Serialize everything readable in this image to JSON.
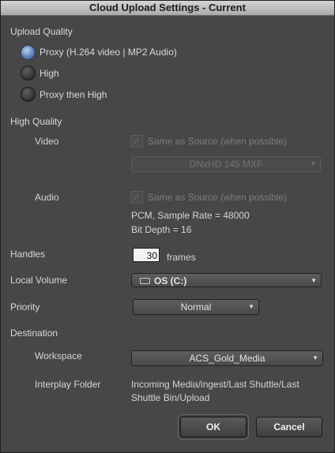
{
  "window": {
    "title": "Cloud Upload Settings - Current"
  },
  "upload_quality": {
    "heading": "Upload Quality",
    "options": [
      {
        "label": "Proxy (H.264 video | MP2 Audio)",
        "selected": true
      },
      {
        "label": "High",
        "selected": false
      },
      {
        "label": "Proxy then High",
        "selected": false
      }
    ]
  },
  "high_quality": {
    "heading": "High Quality",
    "video": {
      "label": "Video",
      "same_as_source": "Same as Source (when possible)",
      "checked": true,
      "format": "DNxHD 145  MXF"
    },
    "audio": {
      "label": "Audio",
      "same_as_source": "Same as Source (when possible)",
      "checked": true,
      "sample_rate": "PCM, Sample Rate = 48000",
      "bit_depth": "Bit Depth = 16"
    }
  },
  "handles": {
    "label": "Handles",
    "value": "30",
    "unit": "frames"
  },
  "local_volume": {
    "label": "Local Volume",
    "value": "OS (C:)"
  },
  "priority": {
    "label": "Priority",
    "value": "Normal"
  },
  "destination": {
    "heading": "Destination",
    "workspace_label": "Workspace",
    "workspace_value": "ACS_Gold_Media",
    "folder_label": "Interplay Folder",
    "folder_line1": "Incoming Media/ingest/Last Shuttle/Last",
    "folder_line2": "Shuttle Bin/Upload"
  },
  "buttons": {
    "ok": "OK",
    "cancel": "Cancel"
  },
  "icons": {
    "checkmark": "✓",
    "dropdown_arrow": "▼"
  }
}
